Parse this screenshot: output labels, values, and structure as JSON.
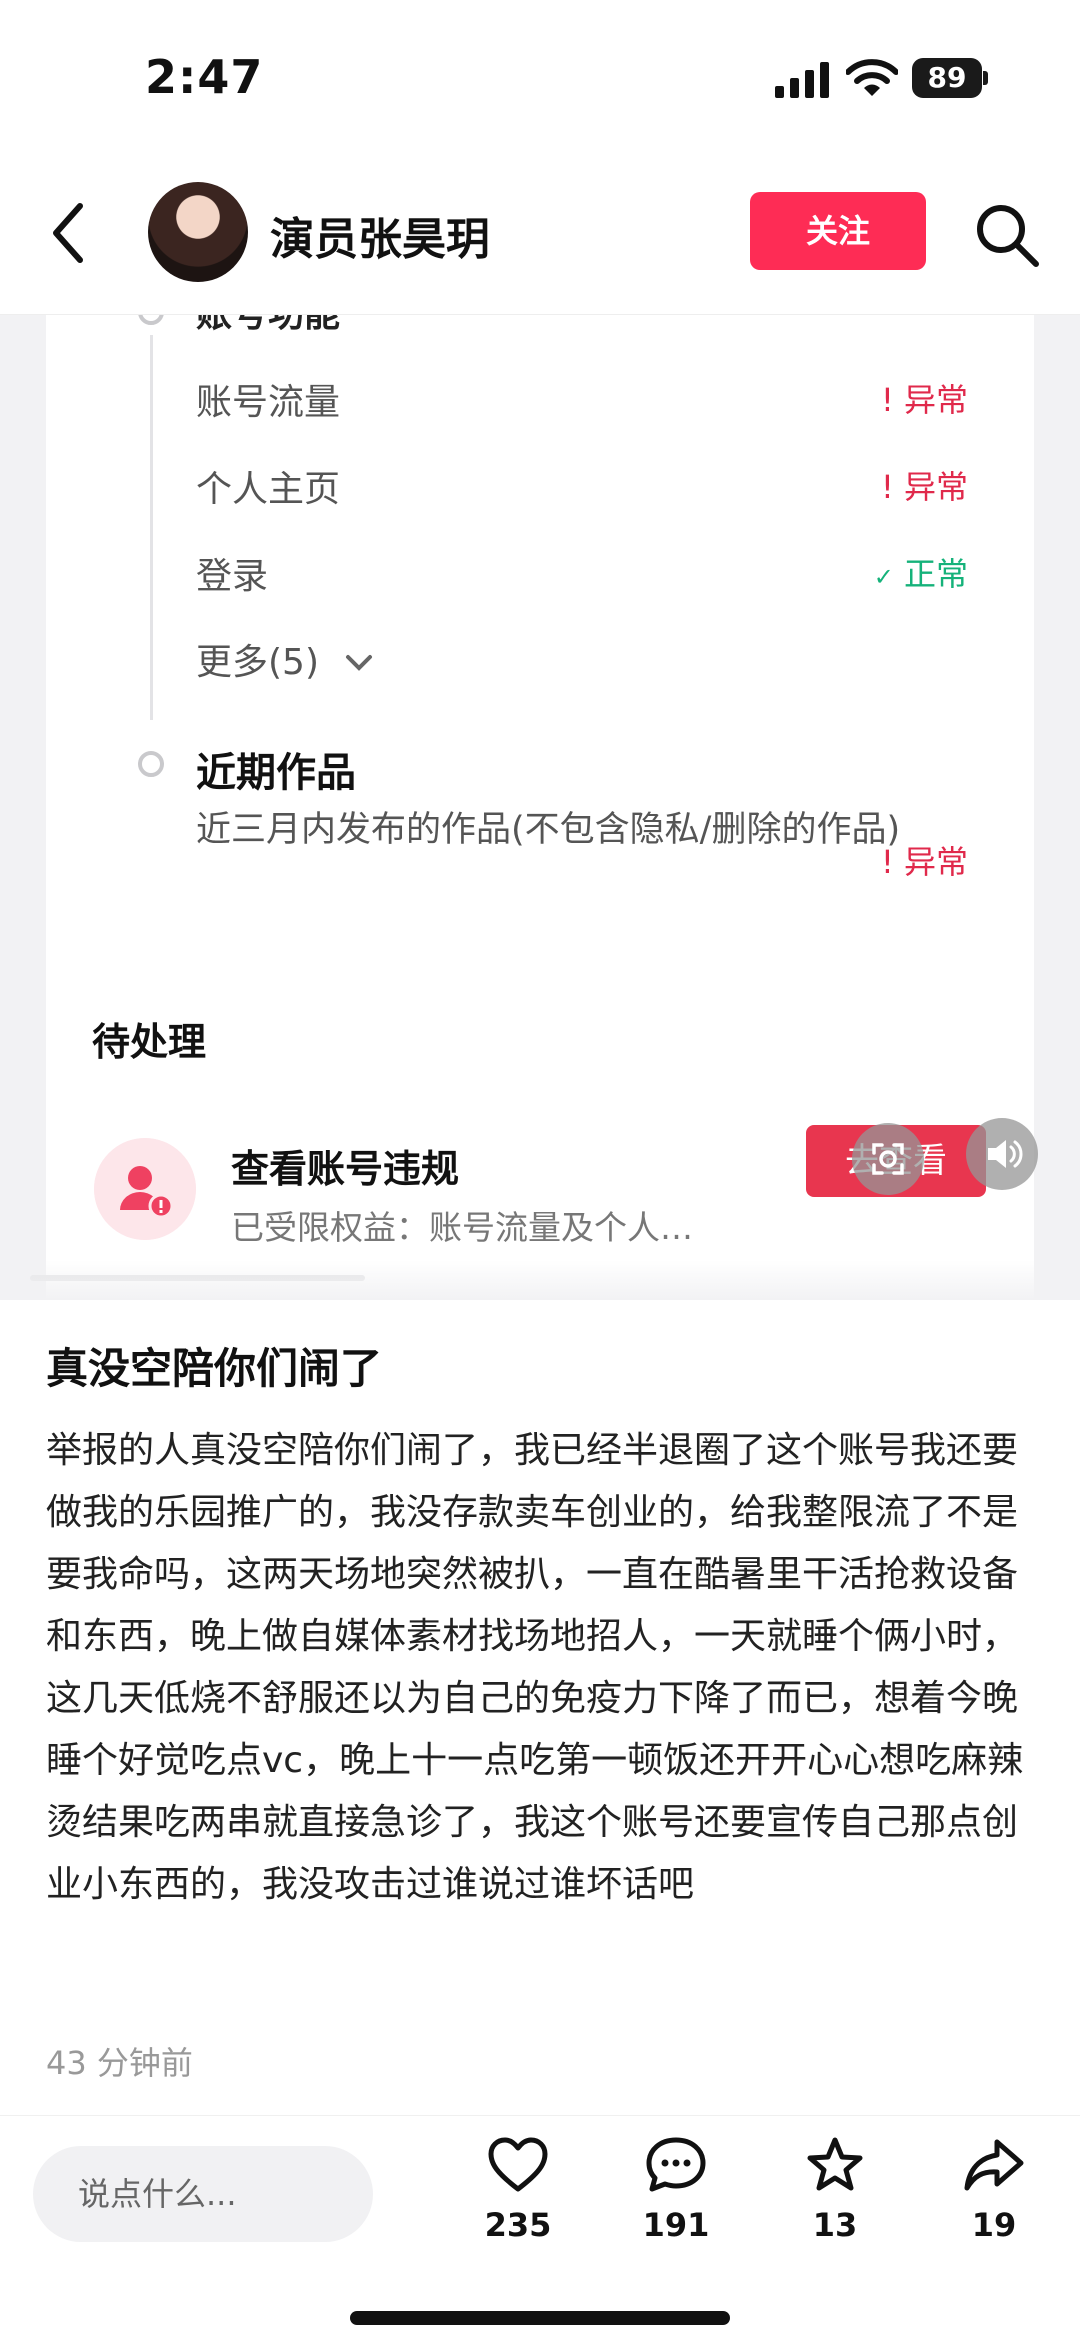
{
  "status_bar": {
    "time": "2:47",
    "battery": "89"
  },
  "nav": {
    "title": "演员张昊玥",
    "follow_label": "关注"
  },
  "screenshot": {
    "section_heading_cut": "账号功能",
    "rows": [
      {
        "label": "账号流量",
        "status_mark": "!",
        "status": "异常",
        "state": "bad"
      },
      {
        "label": "个人主页",
        "status_mark": "!",
        "status": "异常",
        "state": "bad"
      },
      {
        "label": "登录",
        "status_mark": "✓",
        "status": "正常",
        "state": "good"
      }
    ],
    "more_label": "更多(5)",
    "recent_title": "近期作品",
    "recent_desc": "近三月内发布的作品(不包含隐私/删除的作品)",
    "recent_status_mark": "!",
    "recent_status": "异常",
    "pending_title": "待处理",
    "violation_title": "查看账号违规",
    "violation_sub": "已受限权益：账号流量及个人…",
    "check_label": "去查看"
  },
  "post": {
    "title": "真没空陪你们闹了",
    "body": "举报的人真没空陪你们闹了，我已经半退圈了这个账号我还要做我的乐园推广的，我没存款卖车创业的，给我整限流了不是要我命吗，这两天场地突然被扒，一直在酷暑里干活抢救设备和东西，晚上做自媒体素材找场地招人，一天就睡个俩小时，这几天低烧不舒服还以为自己的免疫力下降了而已，想着今晚睡个好觉吃点vc，晚上十一点吃第一顿饭还开开心心想吃麻辣烫结果吃两串就直接急诊了，我这个账号还要宣传自己那点创业小东西的，我没攻击过谁说过谁坏话吧",
    "time": "43 分钟前"
  },
  "bottom_bar": {
    "comment_placeholder": "说点什么...",
    "likes": "235",
    "comments": "191",
    "favorites": "13",
    "shares": "19"
  },
  "colors": {
    "accent": "#fe2c55",
    "bad": "#e0294b",
    "good": "#15b27a"
  }
}
